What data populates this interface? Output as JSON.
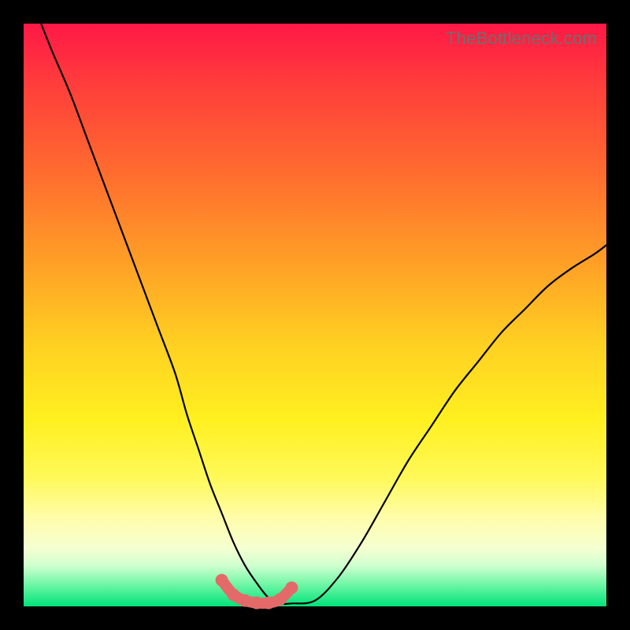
{
  "watermark": "TheBottleneck.com",
  "colors": {
    "background_frame": "#000000",
    "gradient_top": "#ff1846",
    "gradient_bottom": "#00e37a",
    "curve": "#000000",
    "marker": "#e46a6a",
    "watermark": "#6e6e6e"
  },
  "chart_data": {
    "type": "line",
    "title": "",
    "xlabel": "",
    "ylabel": "",
    "xlim": [
      0,
      100
    ],
    "ylim": [
      0,
      100
    ],
    "series": [
      {
        "name": "bottleneck-curve",
        "x": [
          3,
          5,
          8,
          11,
          14,
          17,
          20,
          23,
          26,
          28,
          30,
          32,
          34,
          36,
          38,
          40,
          42,
          44,
          46,
          50,
          54,
          58,
          62,
          66,
          70,
          74,
          78,
          82,
          86,
          90,
          94,
          98,
          100
        ],
        "y": [
          100,
          95,
          88,
          80,
          72,
          64,
          56,
          48,
          40,
          33,
          27,
          21,
          16,
          11,
          7,
          4,
          1.5,
          0.5,
          0.5,
          1,
          5,
          11,
          18,
          25,
          31,
          37,
          42,
          47,
          51,
          55,
          58,
          60.5,
          62
        ]
      }
    ],
    "highlight": {
      "name": "optimal-region",
      "x": [
        34,
        36,
        38,
        40,
        42,
        44,
        46
      ],
      "y": [
        4.5,
        2,
        1,
        0.6,
        0.6,
        1.2,
        3.2
      ]
    }
  }
}
